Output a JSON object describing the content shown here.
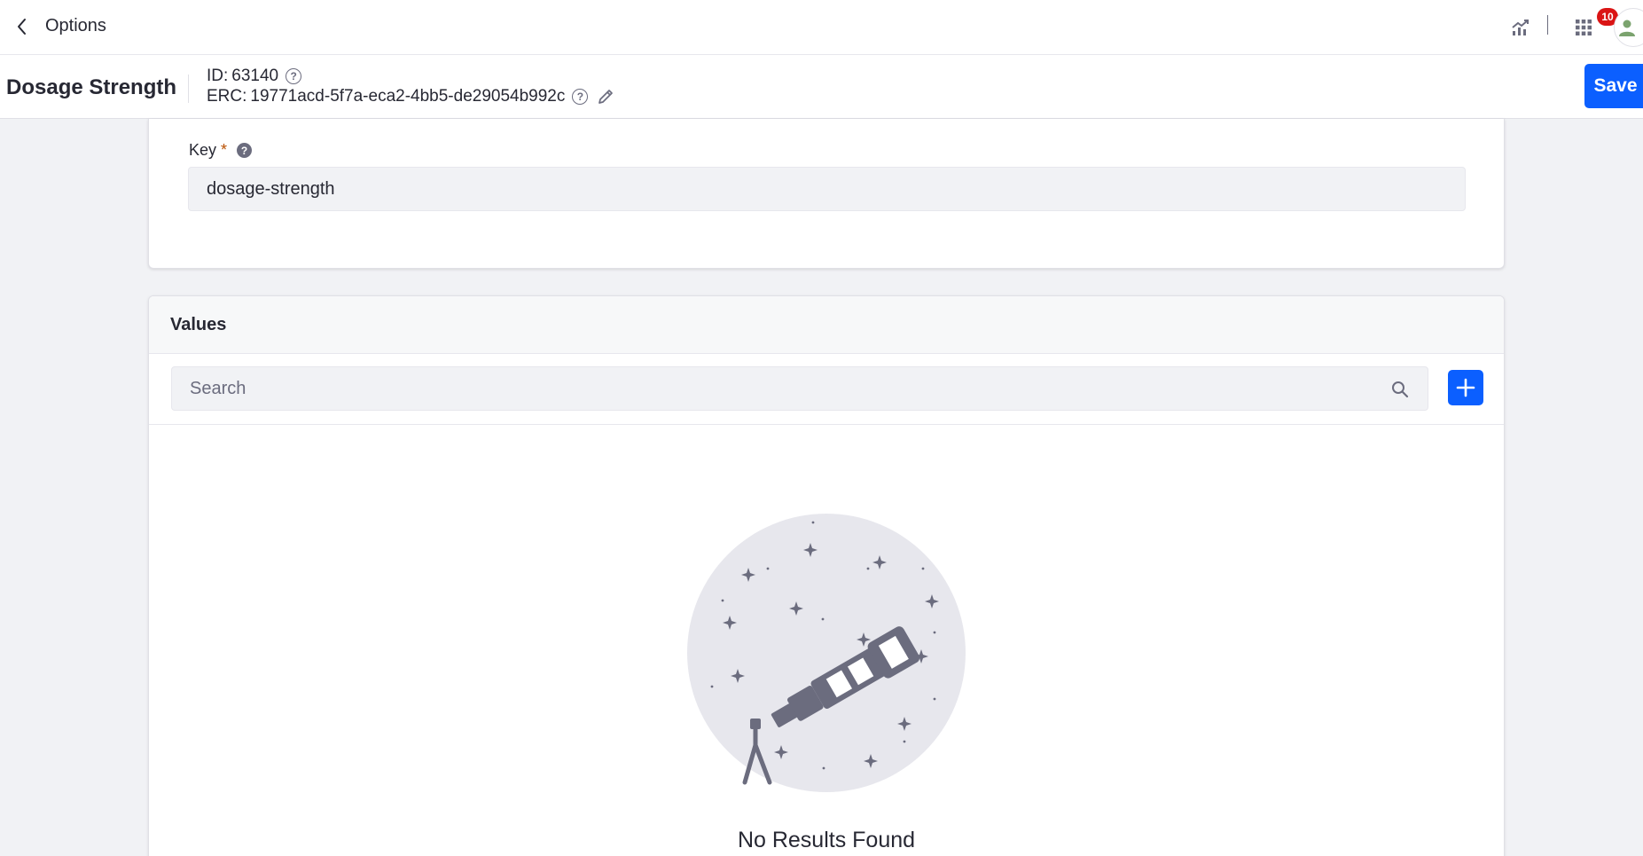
{
  "topbar": {
    "back_icon": "chevron-left-icon",
    "title": "Options",
    "analytics_icon": "analytics-icon",
    "apps_icon": "grid-icon",
    "notification_count": "10",
    "avatar_icon": "user-icon"
  },
  "header": {
    "entity_title": "Dosage Strength",
    "id_label": "ID:",
    "id_value": "63140",
    "erc_label": "ERC:",
    "erc_value": "19771acd-5f7a-eca2-4bb5-de29054b992c",
    "help_icon": "question-circle-icon",
    "edit_icon": "pencil-icon",
    "save_label": "Save",
    "save_color": "#0b5fff"
  },
  "key_field": {
    "label": "Key",
    "required_mark": "*",
    "help_icon": "question-circle-filled-icon",
    "value": "dosage-strength"
  },
  "values_panel": {
    "title": "Values",
    "search_placeholder": "Search",
    "search_icon": "search-icon",
    "add_icon": "plus-icon",
    "empty_illustration": "telescope-illustration",
    "empty_title": "No Results Found"
  }
}
